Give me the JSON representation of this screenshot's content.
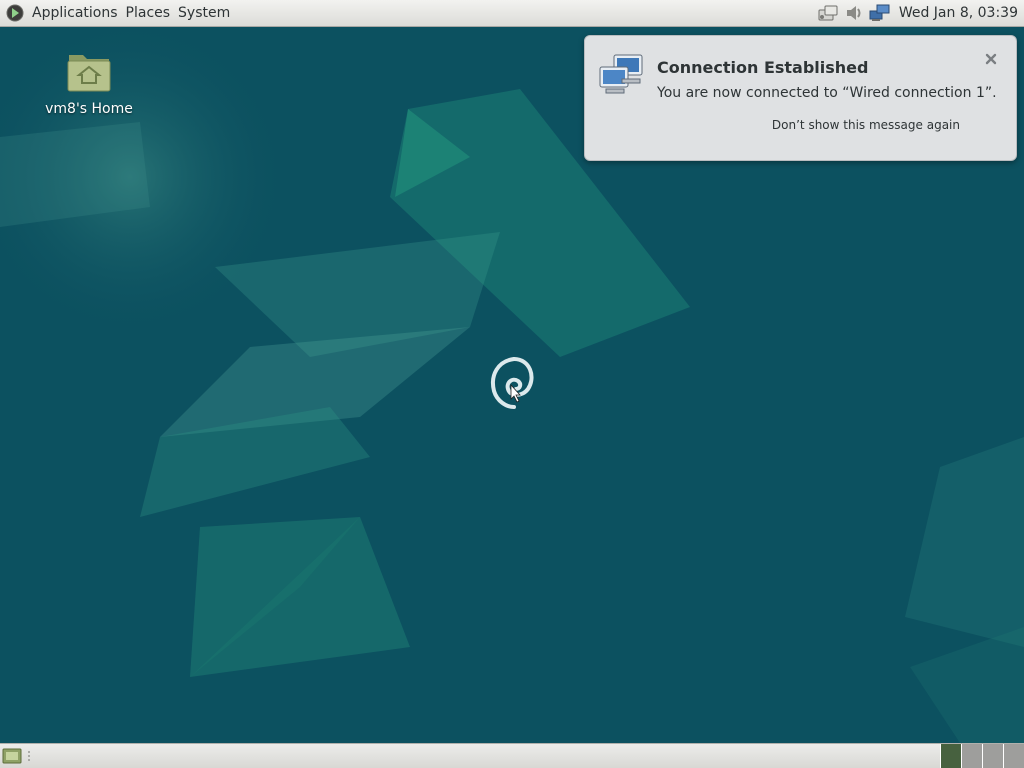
{
  "top_panel": {
    "menus": [
      "Applications",
      "Places",
      "System"
    ],
    "clock": "Wed Jan 8, 03:39",
    "tray_icons": [
      "network-status-icon",
      "volume-icon",
      "network-manager-icon"
    ]
  },
  "desktop": {
    "icons": [
      {
        "label": "vm8's Home",
        "icon": "home-folder-icon"
      }
    ],
    "logo": "debian-swirl-icon"
  },
  "notification": {
    "title": "Connection Established",
    "body": "You are now connected to “Wired connection 1”.",
    "action": "Don’t show this message again",
    "icon": "network-wired-icon",
    "close_icon": "close-icon"
  },
  "bottom_panel": {
    "workspaces": 4,
    "active_workspace": 1
  },
  "colors": {
    "desktop_bg": "#0c5160",
    "accent": "#2aa58a",
    "panel_bg": "#dcdcd8",
    "notification_bg": "#dfe1e3",
    "workspace_active": "#47613f"
  }
}
